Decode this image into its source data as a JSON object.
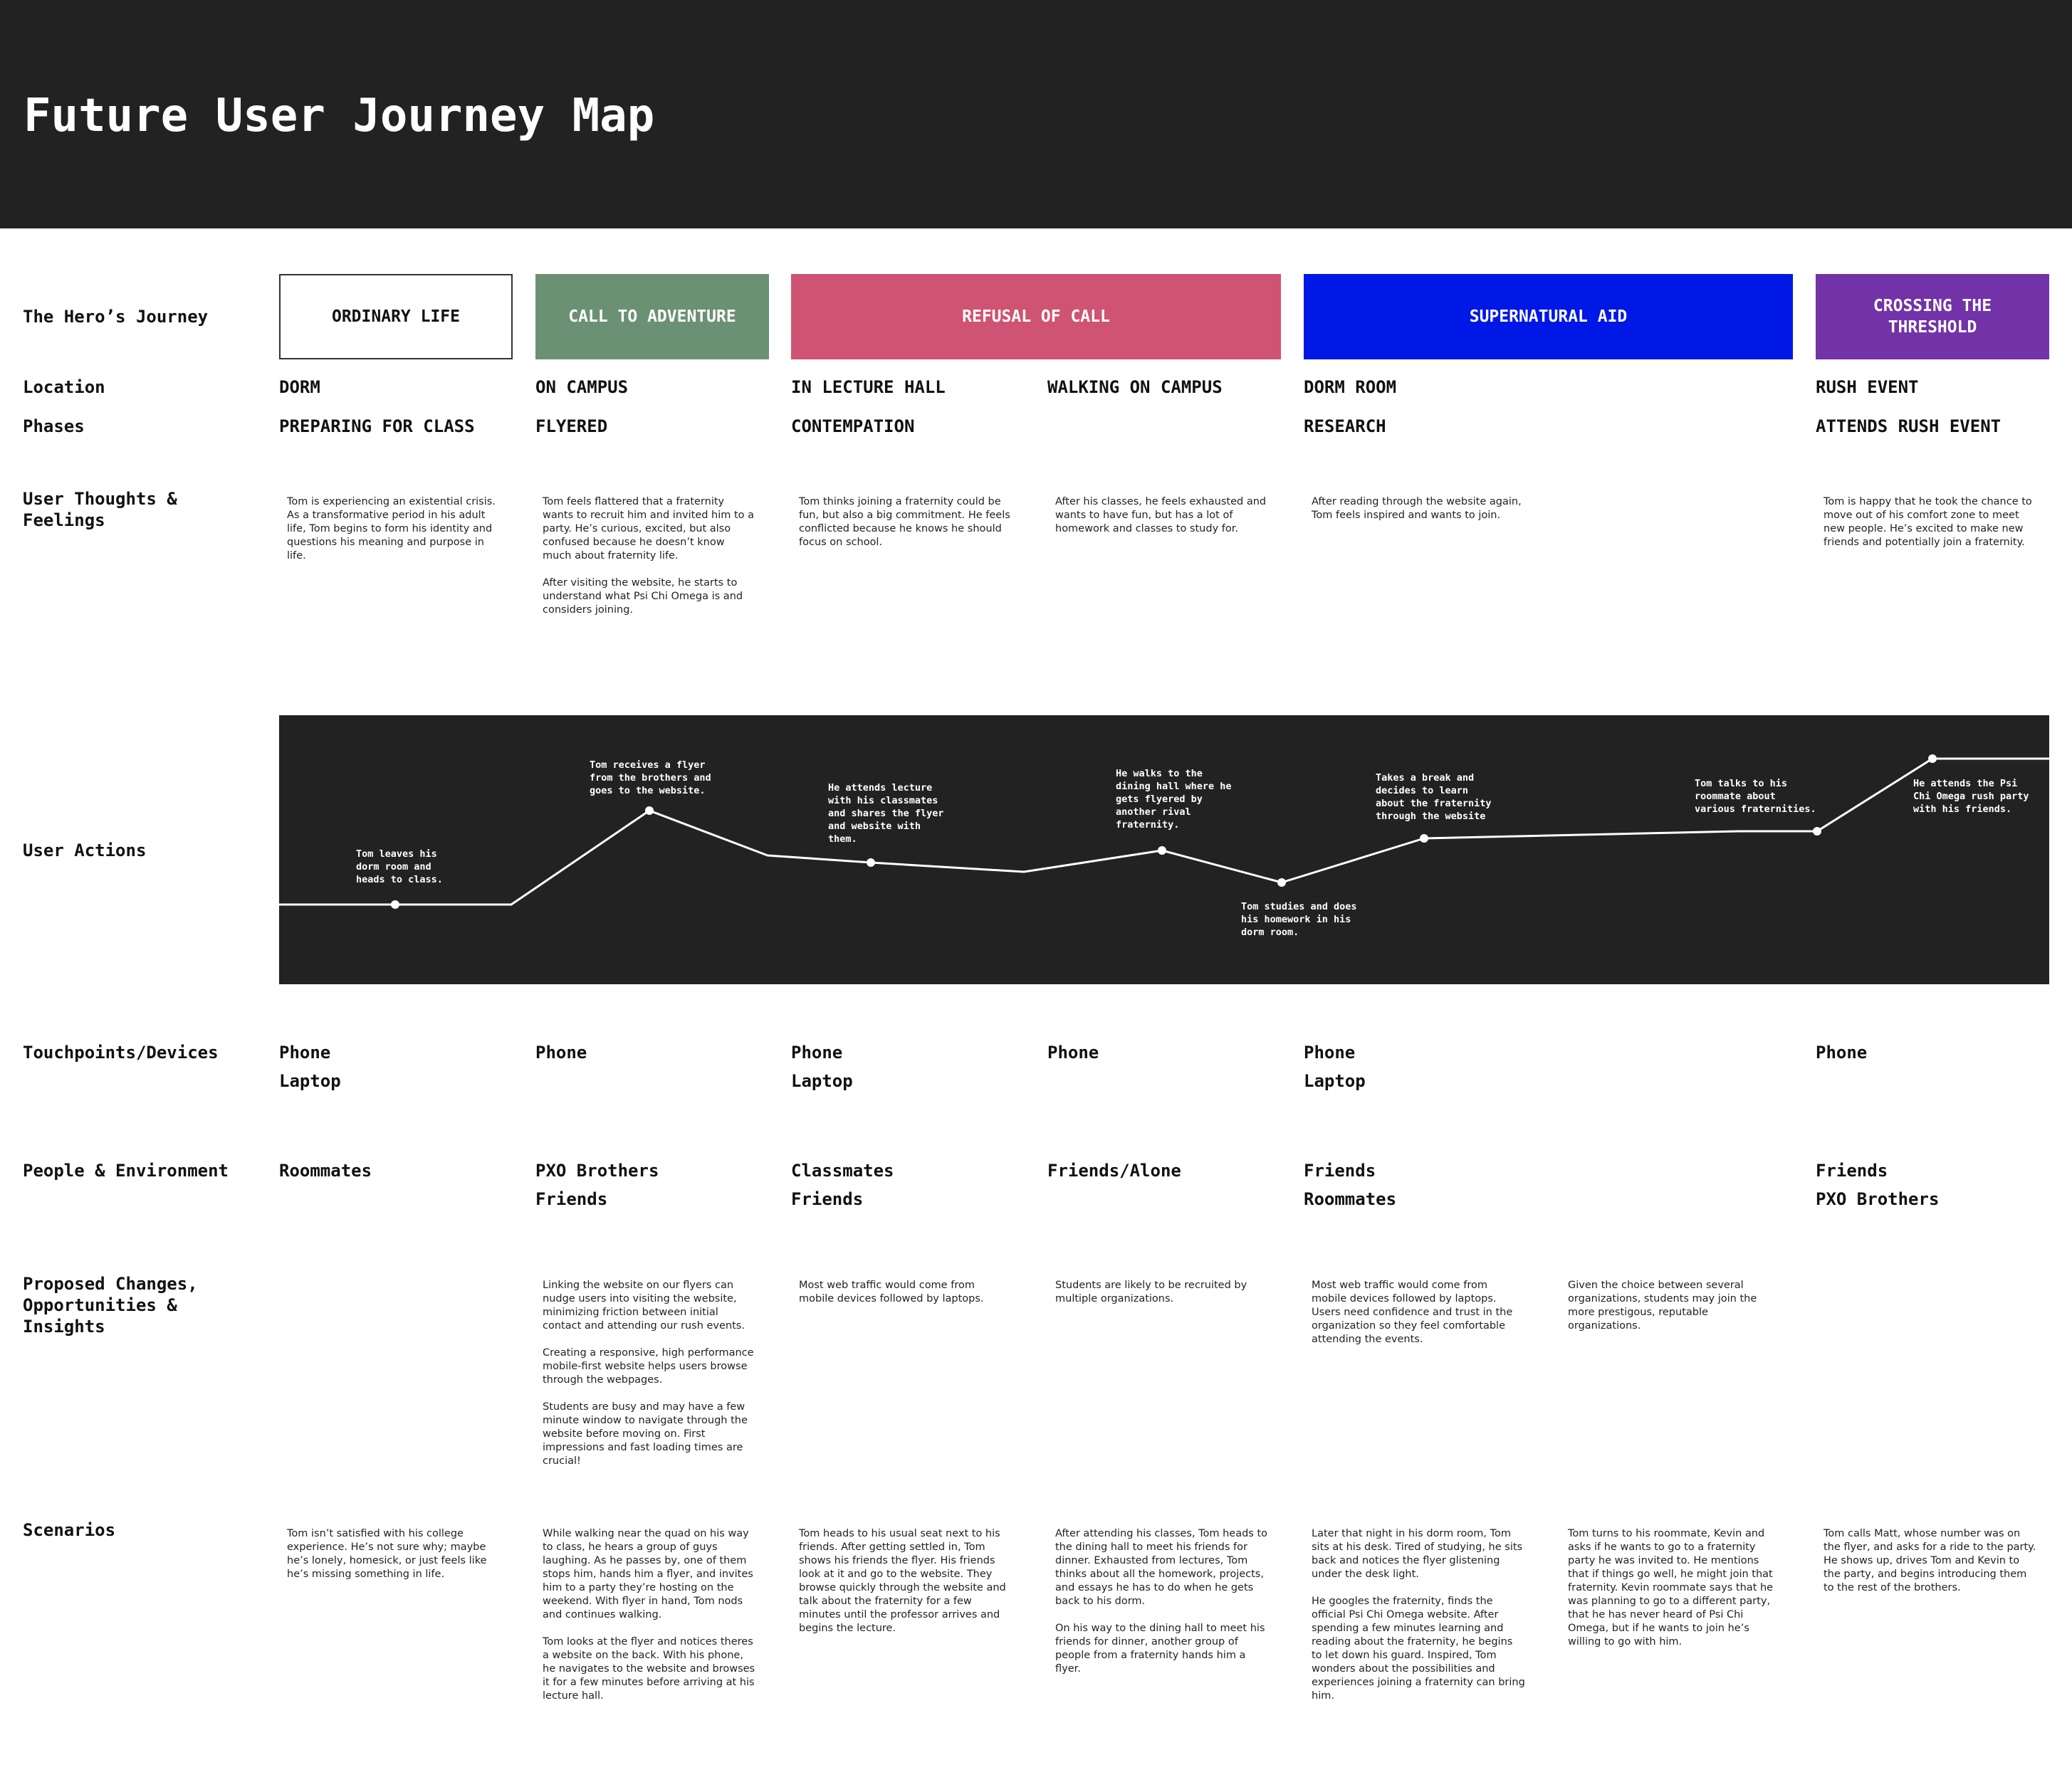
{
  "title": "Future User Journey Map",
  "row_labels": {
    "hero": "The Hero’s Journey",
    "location": "Location",
    "phases": "Phases",
    "thoughts": "User Thoughts & Feelings",
    "actions": "User Actions",
    "touchpoints": "Touchpoints/Devices",
    "people": "People & Environment",
    "changes": "Proposed Changes, Opportunities & Insights",
    "scenarios": "Scenarios"
  },
  "stages": [
    {
      "label": "ORDINARY LIFE",
      "color": "#ffffff",
      "text_color": "#111111",
      "border": "#333333"
    },
    {
      "label": "CALL TO ADVENTURE",
      "color": "#6b9174",
      "text_color": "#ffffff"
    },
    {
      "label": "REFUSAL OF CALL",
      "color": "#cf5372",
      "text_color": "#ffffff"
    },
    {
      "label": "SUPERNATURAL AID",
      "color": "#0018e5",
      "text_color": "#ffffff"
    },
    {
      "label": "CROSSING THE THRESHOLD",
      "color": "#7232a8",
      "text_color": "#ffffff"
    }
  ],
  "locations": [
    "DORM",
    "ON CAMPUS",
    "IN LECTURE HALL",
    "WALKING ON CAMPUS",
    "DORM ROOM",
    "RUSH EVENT"
  ],
  "phases": [
    "PREPARING FOR CLASS",
    "FLYERED",
    "CONTEMPATION",
    "RESEARCH",
    "ATTENDS RUSH EVENT"
  ],
  "thoughts": [
    [
      "Tom is experiencing an existential crisis. As a transformative period in his adult life, Tom begins to form his identity and questions his meaning and purpose in life."
    ],
    [
      "Tom feels flattered that a fraternity wants to recruit him and invited him to a party. He’s curious, excited, but also confused because he doesn’t know much about fraternity life.",
      "After visiting the website, he starts to understand what Psi Chi Omega is and considers joining."
    ],
    [
      "Tom thinks joining a fraternity could be fun, but also a big commitment. He feels conflicted because he knows he should focus on school."
    ],
    [
      "After his classes, he feels exhausted and wants to have fun, but has a lot of homework and classes to study for."
    ],
    [
      "After reading through the website again, Tom feels inspired and wants to join."
    ],
    [
      "Tom is happy that he took the chance to move out of his comfort zone to meet new people. He’s excited to make new friends and potentially join a fraternity."
    ]
  ],
  "actions": [
    "Tom leaves his\ndorm room and\nheads to class.",
    "Tom receives a flyer\nfrom the brothers and\ngoes to the website.",
    "He attends lecture\nwith his classmates\nand shares the flyer\nand website with\nthem.",
    "He walks to the\ndining hall where he\ngets flyered by\nanother rival\nfraternity.",
    "Tom studies and does\nhis homework in his\ndorm room.",
    "Takes a break and\ndecides to learn\nabout the fraternity\nthrough the website",
    "Tom talks to his\nroommate about\nvarious fraternities.",
    "He attends the Psi\nChi Omega rush party\nwith his friends."
  ],
  "touchpoints": [
    [
      "Phone",
      "Laptop"
    ],
    [
      "Phone"
    ],
    [
      "Phone",
      "Laptop"
    ],
    [
      "Phone"
    ],
    [
      "Phone",
      "Laptop"
    ],
    [
      "Phone"
    ]
  ],
  "people": [
    [
      "Roommates"
    ],
    [
      "PXO Brothers",
      "Friends"
    ],
    [
      "Classmates",
      "Friends"
    ],
    [
      "Friends/Alone"
    ],
    [
      "Friends",
      "Roommates"
    ],
    [
      "Friends",
      "PXO Brothers"
    ]
  ],
  "changes": [
    [
      "Linking the website on our flyers can nudge users into visiting the website, minimizing friction between initial contact and attending our rush events.",
      "Creating a responsive, high performance mobile-first website helps users browse through the webpages.",
      "Students are busy and may have a few minute window to navigate through the website before moving on. First impressions and fast loading times are crucial!"
    ],
    [
      "Most web traffic would come from mobile devices followed by laptops."
    ],
    [
      "Students are likely to be recruited by multiple organizations."
    ],
    [
      "Most web traffic would come from mobile devices followed by laptops. Users need confidence and trust in the organization so they feel comfortable attending the events."
    ],
    [
      "Given the choice between several organizations, students may join the more prestigous, reputable organizations."
    ]
  ],
  "scenarios": [
    [
      "Tom isn’t satisfied with his college experience. He’s not sure why; maybe he’s lonely, homesick, or just feels like he’s missing something in life."
    ],
    [
      "While walking near the quad on his way to class, he hears a group of guys laughing. As he passes by, one of them stops him, hands him a flyer, and invites him to a party they’re hosting on the weekend. With flyer in hand, Tom nods and continues walking.",
      "Tom looks at the flyer and notices theres a website on the back. With his phone, he navigates to the website and browses it for a few minutes before arriving at his lecture hall."
    ],
    [
      "Tom heads to his usual seat next to his friends. After getting settled in, Tom shows his friends the flyer. His friends look at it and go to the website. They browse quickly through the website and talk about the fraternity for a few minutes until the professor arrives and begins the lecture."
    ],
    [
      "After attending his classes, Tom heads to the dining hall to meet his friends for dinner. Exhausted from lectures, Tom thinks about all the homework, projects, and essays he has to do when he gets back to his dorm.",
      "On his way to the dining hall to meet his friends for dinner, another group of people from a fraternity hands him a flyer."
    ],
    [
      "Later that night in his dorm room, Tom sits at his desk. Tired of studying, he sits back and notices the flyer glistening under the desk light.",
      "He googles the fraternity, finds the official Psi Chi Omega website. After spending a few minutes learning and reading about the fraternity, he begins to let down his guard. Inspired, Tom wonders about the possibilities and experiences joining a fraternity can bring him."
    ],
    [
      "Tom turns to his roommate, Kevin and asks if he wants to go to a fraternity party he was invited to. He mentions that if things go well, he might join that fraternity. Kevin roommate says that he was planning to go to a different party, that he has never heard of Psi Chi Omega, but if he wants to join he’s willing to go with him."
    ],
    [
      "Tom calls Matt, whose number was on the flyer, and asks for a ride to the party. He shows up, drives Tom and Kevin to the party, and begins introducing them to the rest of the brothers."
    ]
  ]
}
